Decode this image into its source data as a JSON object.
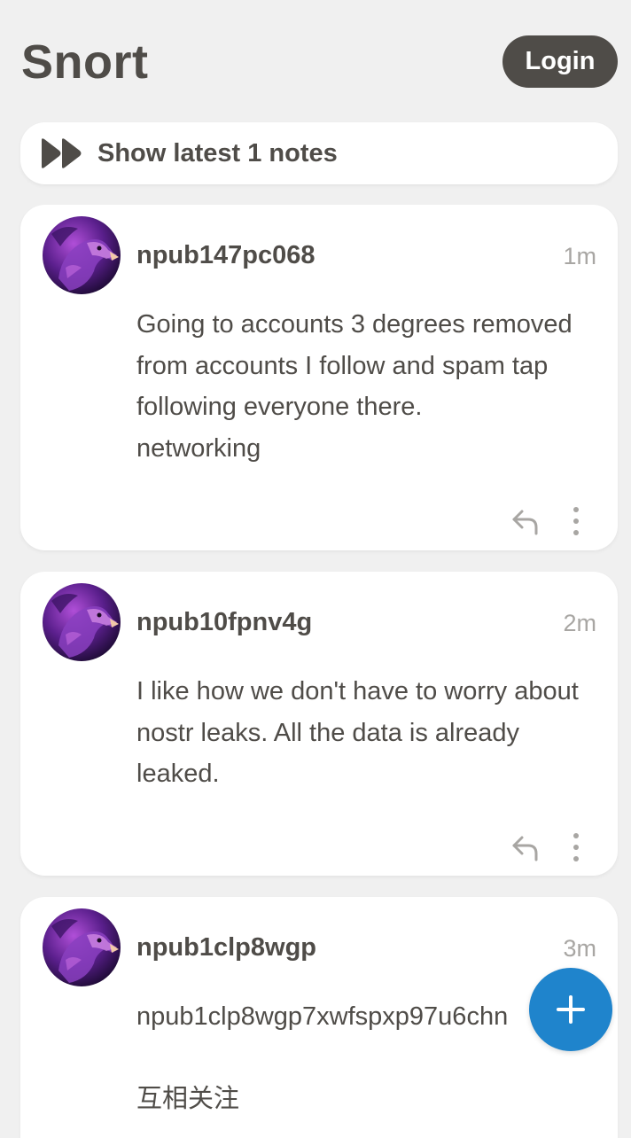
{
  "app": {
    "brand": "Snort",
    "login_label": "Login"
  },
  "feed": {
    "show_latest_label": "Show latest 1 notes",
    "notes": [
      {
        "author": "npub147pc068",
        "time": "1m",
        "content": "Going to accounts 3 degrees removed from accounts I follow and spam tap following everyone there.\nnetworking"
      },
      {
        "author": "npub10fpnv4g",
        "time": "2m",
        "content": "I like how we don't have to worry about nostr leaks. All the data is already leaked."
      },
      {
        "author": "npub1clp8wgp",
        "time": "3m",
        "content": "npub1clp8wgp7xwfspxp97u6chn\n\n互相关注"
      }
    ]
  },
  "icons": {
    "show_latest": "fast-forward-icon",
    "reply": "reply-icon",
    "more": "more-vertical-icon",
    "compose": "plus-icon"
  },
  "colors": {
    "background": "#f0f0f0",
    "text": "#4f4c48",
    "muted": "#a8a6a3",
    "accent": "#1f84cc",
    "card": "#ffffff"
  }
}
